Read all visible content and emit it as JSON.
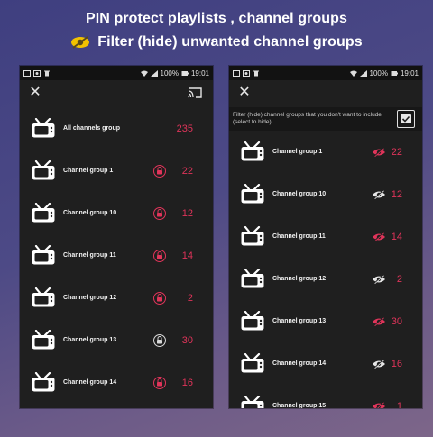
{
  "headline": {
    "line1": "PIN protect playlists , channel groups",
    "line2": "Filter (hide) unwanted channel groups"
  },
  "status": {
    "battery": "100%",
    "time": "19:01"
  },
  "left": {
    "rows": [
      {
        "label": "All channels group",
        "count": "235",
        "lock": "none"
      },
      {
        "label": "Channel group 1",
        "count": "22",
        "lock": "red"
      },
      {
        "label": "Channel group 10",
        "count": "12",
        "lock": "red"
      },
      {
        "label": "Channel group 11",
        "count": "14",
        "lock": "red"
      },
      {
        "label": "Channel group 12",
        "count": "2",
        "lock": "red"
      },
      {
        "label": "Channel group 13",
        "count": "30",
        "lock": "white"
      },
      {
        "label": "Channel group 14",
        "count": "16",
        "lock": "red"
      }
    ]
  },
  "right": {
    "filter_text": "Filter (hide) channel groups that you don't want to include (select to hide)",
    "filter_checked": true,
    "rows": [
      {
        "label": "Channel group 1",
        "count": "22",
        "eye": "hidden-red"
      },
      {
        "label": "Channel group 10",
        "count": "12",
        "eye": "visible-white"
      },
      {
        "label": "Channel group 11",
        "count": "14",
        "eye": "hidden-red"
      },
      {
        "label": "Channel group 12",
        "count": "2",
        "eye": "visible-white"
      },
      {
        "label": "Channel group 13",
        "count": "30",
        "eye": "hidden-red"
      },
      {
        "label": "Channel group 14",
        "count": "16",
        "eye": "visible-white"
      },
      {
        "label": "Channel group 15",
        "count": "1",
        "eye": "hidden-red"
      }
    ]
  },
  "colors": {
    "accent": "#e0345a",
    "background": "#1f1f1f",
    "text": "#f2f2f2",
    "headline_icon": "#f2c200"
  }
}
